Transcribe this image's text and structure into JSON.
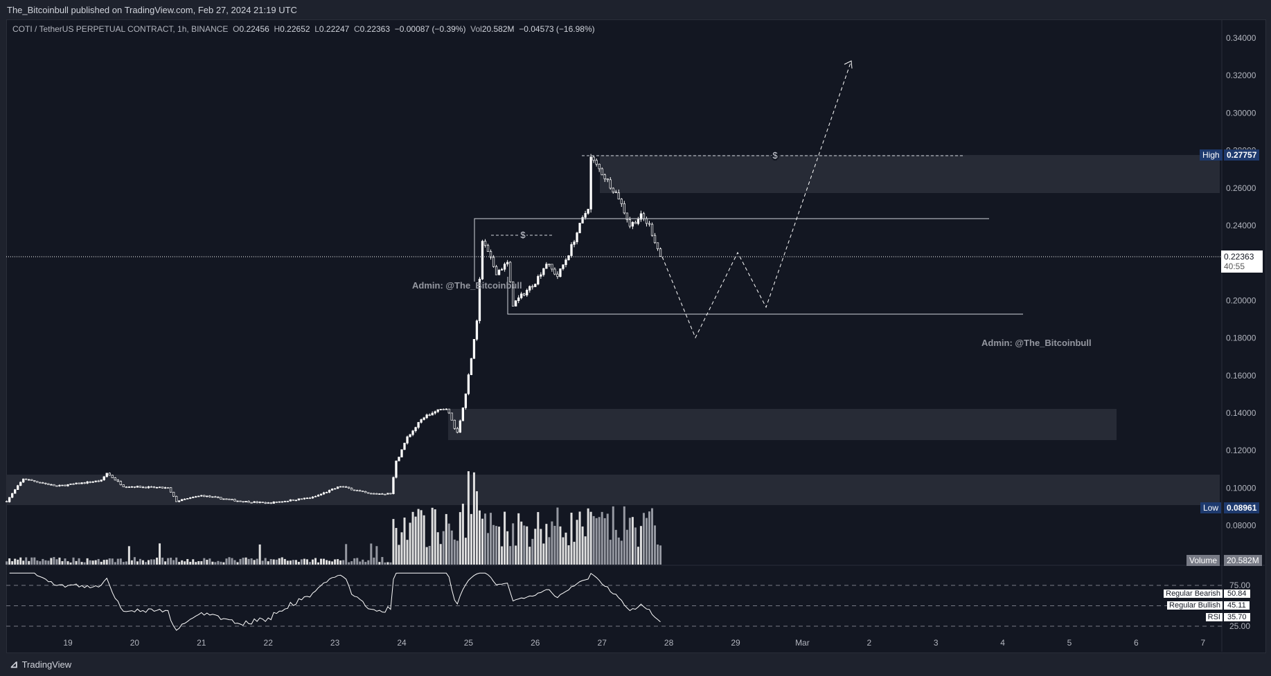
{
  "header": {
    "published": "The_Bitcoinbull published on TradingView.com, Feb 27, 2024 21:19 UTC"
  },
  "legend": {
    "symbol": "COTI / TetherUS PERPETUAL CONTRACT, 1h, BINANCE",
    "o_label": "O",
    "open": "0.22456",
    "h_label": "H",
    "high": "0.22652",
    "l_label": "L",
    "low": "0.22247",
    "c_label": "C",
    "close": "0.22363",
    "change": "−0.00087 (−0.39%)",
    "vol_label": "Vol",
    "volume": "20.582M",
    "vol_change": "−0.04573 (−16.98%)"
  },
  "chart_data": {
    "type": "candlestick",
    "ylim": [
      0.07,
      0.35
    ],
    "price_ticks": [
      "0.34000",
      "0.32000",
      "0.30000",
      "0.28000",
      "0.26000",
      "0.24000",
      "0.20000",
      "0.18000",
      "0.16000",
      "0.14000",
      "0.12000",
      "0.10000",
      "0.08000"
    ],
    "date_ticks": [
      "19",
      "20",
      "21",
      "22",
      "23",
      "24",
      "25",
      "26",
      "27",
      "28",
      "29",
      "Mar",
      "2",
      "3",
      "4",
      "5",
      "6",
      "7"
    ],
    "close_path": [
      [
        "18 02:00",
        0.093
      ],
      [
        "18 08:00",
        0.105
      ],
      [
        "18 20:00",
        0.101
      ],
      [
        "19 12:00",
        0.104
      ],
      [
        "19 14:00",
        0.108
      ],
      [
        "19 20:00",
        0.101
      ],
      [
        "20 12:00",
        0.1
      ],
      [
        "20 15:00",
        0.093
      ],
      [
        "21 00:00",
        0.096
      ],
      [
        "21 14:00",
        0.093
      ],
      [
        "22 00:00",
        0.092
      ],
      [
        "22 16:00",
        0.095
      ],
      [
        "23 02:00",
        0.101
      ],
      [
        "23 12:00",
        0.097
      ],
      [
        "23 20:00",
        0.097
      ],
      [
        "23 22:00",
        0.114
      ],
      [
        "24 02:00",
        0.127
      ],
      [
        "24 08:00",
        0.138
      ],
      [
        "24 16:00",
        0.143
      ],
      [
        "24 20:00",
        0.129
      ],
      [
        "24 23:00",
        0.15
      ],
      [
        "25 01:00",
        0.17
      ],
      [
        "25 03:00",
        0.19
      ],
      [
        "25 05:00",
        0.232
      ],
      [
        "25 10:00",
        0.215
      ],
      [
        "25 14:00",
        0.22
      ],
      [
        "25 16:00",
        0.198
      ],
      [
        "26 00:00",
        0.21
      ],
      [
        "26 04:00",
        0.22
      ],
      [
        "26 08:00",
        0.213
      ],
      [
        "26 12:00",
        0.225
      ],
      [
        "26 16:00",
        0.24
      ],
      [
        "26 19:00",
        0.25
      ],
      [
        "26 20:00",
        0.276
      ],
      [
        "27 00:00",
        0.268
      ],
      [
        "27 06:00",
        0.255
      ],
      [
        "27 10:00",
        0.24
      ],
      [
        "27 14:00",
        0.245
      ],
      [
        "27 17:00",
        0.24
      ],
      [
        "27 21:00",
        0.2236
      ]
    ],
    "high": {
      "label": "High",
      "value": "0.27757"
    },
    "low": {
      "label": "Low",
      "value": "0.08961"
    },
    "last": {
      "value": "0.22363",
      "countdown": "40:55"
    },
    "volume": {
      "label": "Volume",
      "value": "20.582M"
    },
    "rsi": {
      "ticks": [
        "75.00",
        "25.00"
      ],
      "labels": [
        {
          "name": "Regular Bearish",
          "value": "50.84"
        },
        {
          "name": "Regular Bullish",
          "value": "45.11"
        },
        {
          "name": "RSI",
          "value": "35.70"
        }
      ]
    }
  },
  "annotations": {
    "dollar": "$",
    "watermark": "Admin: @The_Bitcoinbull"
  },
  "colors": {
    "bg": "#131722",
    "candle": "#ffffff",
    "zone": "#2a2e39",
    "high_low_badge": "#1e3a6e"
  },
  "footer": {
    "brand": "TradingView"
  }
}
